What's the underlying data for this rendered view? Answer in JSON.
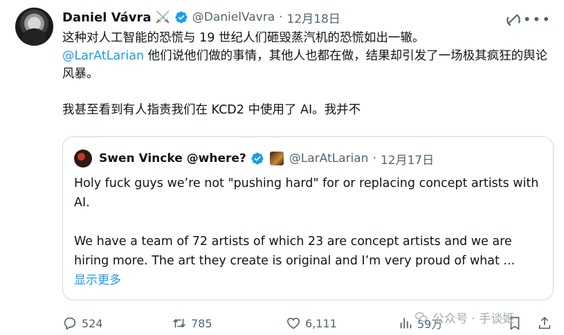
{
  "tweet": {
    "author_name": "Daniel Vávra",
    "author_emoji": "⚔️",
    "author_handle": "@DanielVavra",
    "separator": "·",
    "date": "12月18日",
    "text_line1": "这种对人工智能的恐慌与 19 世纪人们砸毁蒸汽机的恐慌如出一辙。",
    "mention": "@LarAtLarian",
    "text_line2_rest": " 他们说他们做的事情，其他人也都在做，结果却引发了一场极其疯狂的舆论风暴。",
    "text_line3": "我甚至看到有人指责我们在 KCD2 中使用了 AI。我并不"
  },
  "quote": {
    "author_name": "Swen Vincke @where?",
    "author_handle": "@LarAtLarian",
    "separator": "·",
    "date": "12月17日",
    "text_para1": "Holy fuck guys we’re not \"pushing hard\" for or replacing concept artists with AI.",
    "text_para2": "We have a team of 72 artists of which 23 are concept artists and we are hiring more. The art they create is original and I’m very proud of what ...",
    "show_more": "显示更多"
  },
  "actions": {
    "replies": "524",
    "retweets": "785",
    "likes": "6,111",
    "views": "59万"
  },
  "watermark": {
    "text": "公众号 · 手谈姬"
  },
  "colors": {
    "accent": "#1d9bf0",
    "secondary_text": "#536471",
    "border": "#cfd9de"
  },
  "icons": [
    "verified-badge-icon",
    "grok-icon",
    "more-icon",
    "reply-icon",
    "retweet-icon",
    "like-icon",
    "views-icon",
    "bookmark-icon",
    "share-icon",
    "wechat-icon"
  ]
}
